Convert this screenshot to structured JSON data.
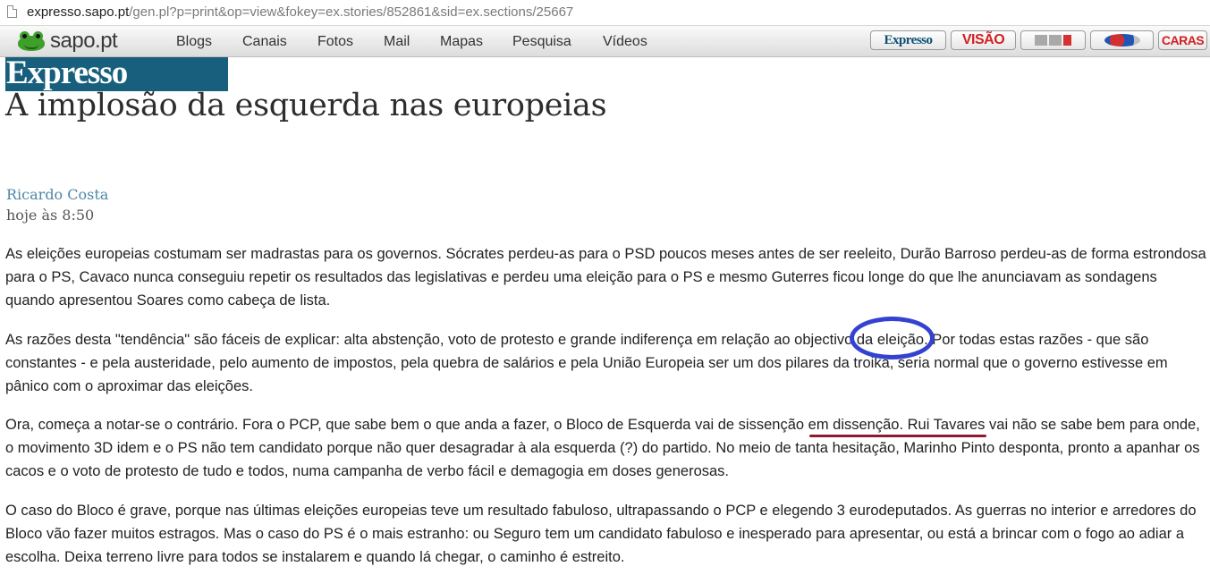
{
  "address_bar": {
    "host": "expresso.sapo.pt",
    "path": "/gen.pl?p=print&op=view&fokey=ex.stories/852861&sid=ex.sections/25667"
  },
  "navbar": {
    "logo_text": "sapo.pt",
    "items": [
      "Blogs",
      "Canais",
      "Fotos",
      "Mail",
      "Mapas",
      "Pesquisa",
      "Vídeos"
    ],
    "brands": {
      "expresso": "Expresso",
      "visao": "VISÃO",
      "caras": "CARAS"
    }
  },
  "article": {
    "masthead": "Expresso",
    "title": "A implosão da esquerda nas europeias",
    "author": "Ricardo Costa",
    "time": "hoje às 8:50",
    "paragraphs": [
      "As eleições europeias costumam ser madrastas para os governos. Sócrates perdeu-as para o PSD poucos meses antes de ser reeleito, Durão Barroso perdeu-as de forma estrondosa para o PS, Cavaco nunca conseguiu repetir os resultados das legislativas e perdeu uma eleição para o PS e mesmo Guterres ficou longe do que lhe anunciavam as sondagens quando apresentou Soares como cabeça de lista.",
      "As razões desta \"tendência\" são fáceis de explicar: alta abstenção, voto de protesto e grande indiferença em relação ao objectivo da eleição. Por todas estas razões - que são constantes - e pela austeridade, pelo aumento de impostos, pela quebra de salários e pela União Europeia ser um dos pilares da troika, seria normal que o governo estivesse em pânico com o aproximar das eleições.",
      "Ora, começa a notar-se o contrário. Fora o PCP, que sabe bem o que anda a fazer, o Bloco de Esquerda vai de sissenção em dissenção. Rui Tavares vai não se sabe bem para onde, o movimento 3D idem e o PS não tem candidato porque não quer desagradar à ala esquerda (?) do partido. No meio de tanta hesitação, Marinho Pinto desponta, pronto a apanhar os cacos e o voto de protesto de tudo e todos, numa campanha de verbo fácil e demagogia em doses generosas.",
      "O caso do Bloco é grave, porque nas últimas eleições europeias teve um resultado fabuloso, ultrapassando o PCP e elegendo 3 eurodeputados. As guerras no interior e arredores do Bloco vão fazer muitos estragos. Mas o caso do PS é o mais estranho: ou Seguro tem um candidato fabuloso e inesperado para apresentar, ou está a brincar com o fogo ao adiar a escolha. Deixa terreno livre para todos se instalarem e quando lá chegar, o caminho é estreito."
    ]
  },
  "annotations": {
    "circle_color": "#3342d0",
    "underline_color": "#8d1b2f"
  }
}
